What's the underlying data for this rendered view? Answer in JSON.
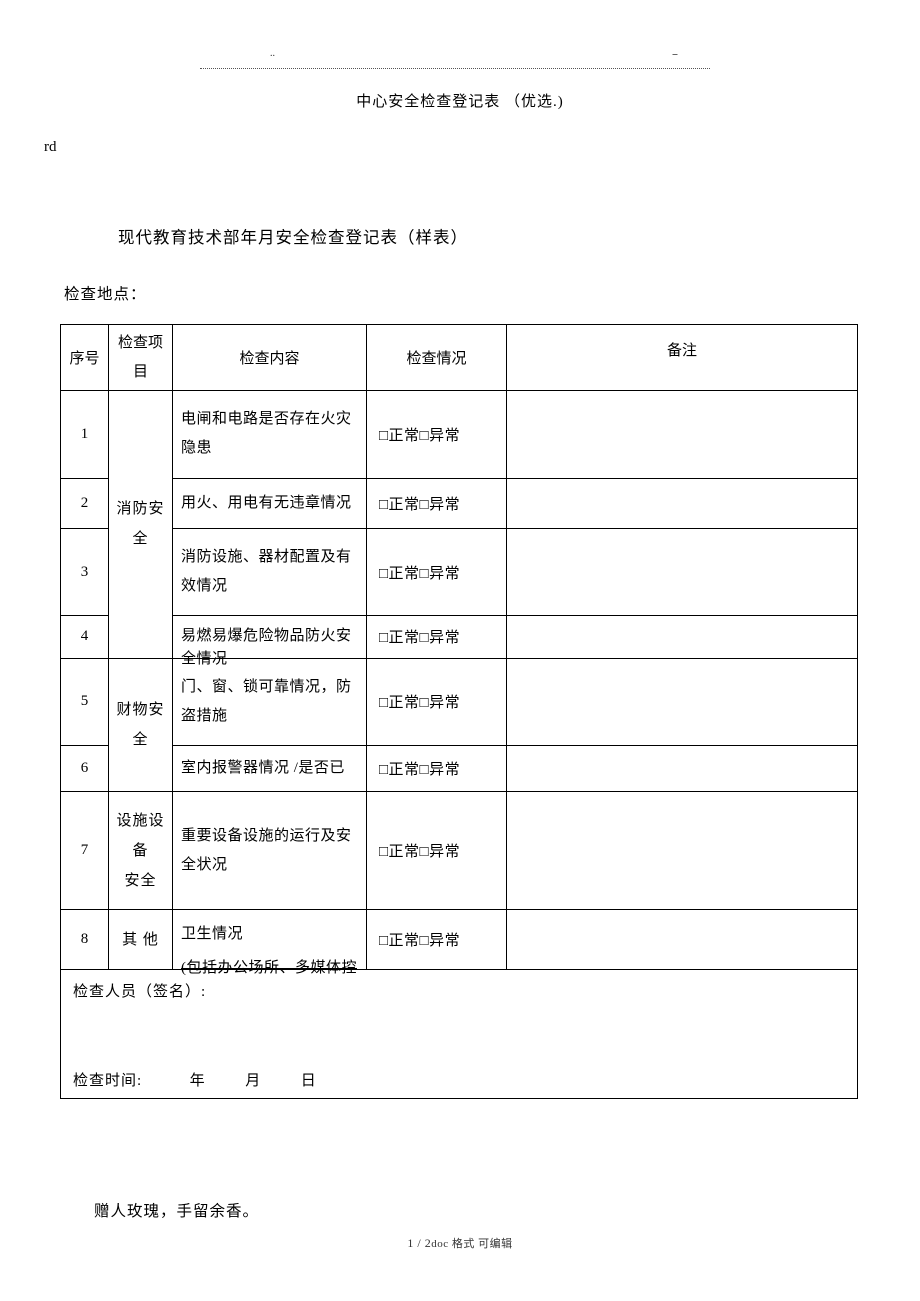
{
  "header": {
    "title": "中心安全检查登记表 （优选.)",
    "rd": "rd",
    "subtitle": "现代教育技术部年月安全检查登记表（样表）",
    "location_label": "检查地点："
  },
  "table": {
    "headers": {
      "seq": "序号",
      "item": "检查项\n目",
      "content": "检查内容",
      "status": "检查情况",
      "remark": "备注"
    },
    "categories": {
      "fire": "消防安\n全",
      "property": "财物安\n全",
      "equipment": "设施设\n备\n安全",
      "other": "其 他"
    },
    "rows": [
      {
        "seq": "1",
        "content": "电闸和电路是否存在火灾隐患",
        "status": "□正常□异常"
      },
      {
        "seq": "2",
        "content": "用火、用电有无违章情况",
        "status": "□正常□异常"
      },
      {
        "seq": "3",
        "content": "消防设施、器材配置及有效情况",
        "status": "□正常□异常"
      },
      {
        "seq": "4",
        "content": "易燃易爆危险物品防火安",
        "status": "□正常□异常",
        "overlap_below": "全情况"
      },
      {
        "seq": "5",
        "content": "门、窗、锁可靠情况，防盗措施",
        "status": "□正常□异常",
        "overlap_top": "全情况"
      },
      {
        "seq": "6",
        "content": "室内报警器情况  /是否已",
        "status": "□正常□异常"
      },
      {
        "seq": "7",
        "content": "重要设备设施的运行及安全状况",
        "status": "□正常□异常"
      },
      {
        "seq": "8",
        "content": "卫生情况",
        "status": "□正常□异常",
        "overlap_below": "(包括办公场所、多媒体控"
      }
    ],
    "footer": {
      "sign_label": "检查人员（签名）:",
      "date_label": "检查时间:",
      "year": "年",
      "month": "月",
      "day": "日"
    }
  },
  "closing": "赠人玫瑰，手留余香。",
  "page_footer": {
    "page": "1 / 2",
    "suffix": "doc 格式  可编辑"
  }
}
